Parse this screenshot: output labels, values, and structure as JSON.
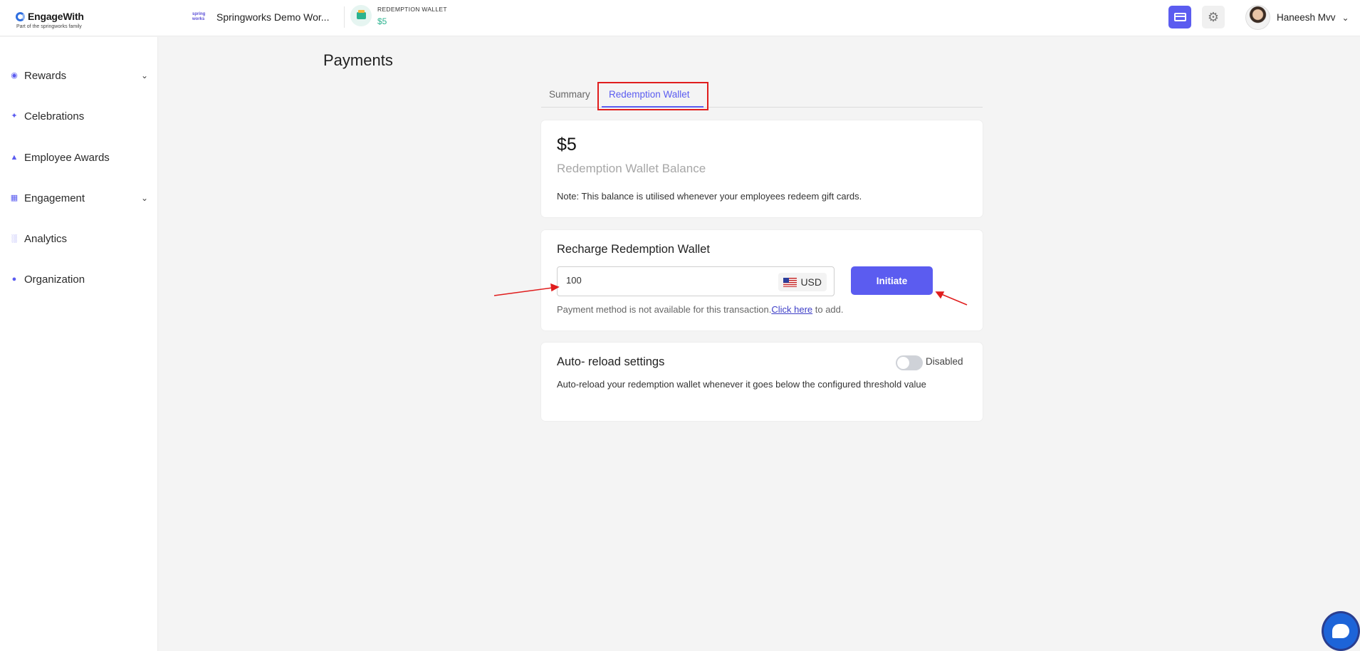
{
  "brand": {
    "name": "EngageWith",
    "tagline": "Part of the springworks family"
  },
  "header": {
    "org_logo": "spring works",
    "org_name": "Springworks Demo Wor...",
    "wallet_label": "REDEMPTION WALLET",
    "wallet_amount": "$5",
    "user_name": "Haneesh Mvv"
  },
  "sidebar": {
    "items": [
      {
        "label": "Rewards",
        "icon": "medal-icon",
        "expandable": true
      },
      {
        "label": "Celebrations",
        "icon": "party-icon",
        "expandable": false
      },
      {
        "label": "Employee Awards",
        "icon": "trophy-icon",
        "expandable": false
      },
      {
        "label": "Engagement",
        "icon": "flow-icon",
        "expandable": true
      },
      {
        "label": "Analytics",
        "icon": "bar-chart-icon",
        "expandable": false
      },
      {
        "label": "Organization",
        "icon": "team-icon",
        "expandable": false
      }
    ]
  },
  "page": {
    "title": "Payments",
    "tabs": [
      {
        "label": "Summary",
        "active": false
      },
      {
        "label": "Redemption Wallet",
        "active": true
      }
    ]
  },
  "balance": {
    "amount": "$5",
    "label": "Redemption Wallet Balance",
    "note": "Note: This balance is utilised whenever your employees redeem gift cards."
  },
  "recharge": {
    "title": "Recharge Redemption Wallet",
    "amount_value": "100",
    "currency": "USD",
    "button_label": "Initiate",
    "note_prefix": "Payment method is not available for this transaction.",
    "note_link": "Click here",
    "note_suffix": " to add."
  },
  "auto_reload": {
    "title": "Auto- reload settings",
    "toggle_state": "Disabled",
    "description": "Auto-reload your redemption wallet whenever it goes below the configured threshold value"
  },
  "colors": {
    "accent": "#5b5cf0",
    "wallet_green": "#2bb38f",
    "annotation_red": "#e01d1d"
  }
}
